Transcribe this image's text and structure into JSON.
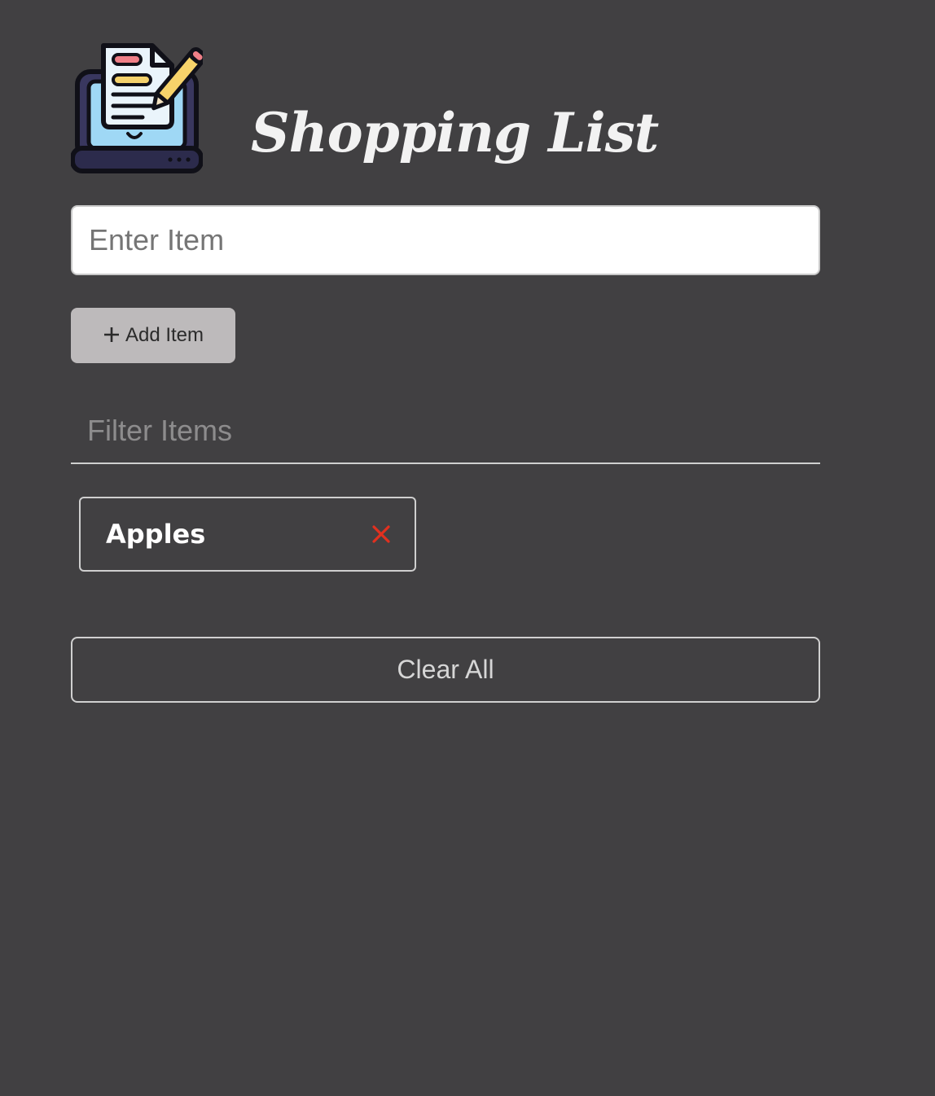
{
  "header": {
    "title": "Shopping List",
    "logo_icon": "notepad-laptop-icon"
  },
  "form": {
    "item_placeholder": "Enter Item",
    "item_value": "",
    "add_button_label": "Add Item",
    "add_button_icon": "plus-icon"
  },
  "filter": {
    "placeholder": "Filter Items",
    "value": ""
  },
  "items": [
    {
      "name": "Apples",
      "remove_icon": "close-icon"
    }
  ],
  "clear_button_label": "Clear All",
  "colors": {
    "background": "#414042",
    "text": "#f2f2f2",
    "add_button_bg": "#bdbabb",
    "remove_icon": "#e1301f"
  }
}
